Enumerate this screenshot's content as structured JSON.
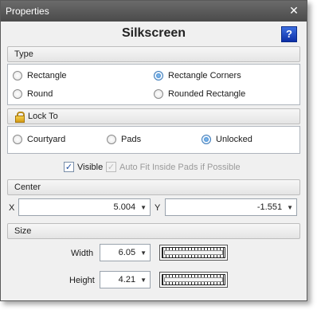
{
  "window": {
    "title": "Properties",
    "close_glyph": "✕"
  },
  "heading": "Silkscreen",
  "help_glyph": "?",
  "type_section": {
    "label": "Type",
    "options": [
      {
        "label": "Rectangle",
        "checked": false
      },
      {
        "label": "Rectangle Corners",
        "checked": true
      },
      {
        "label": "Round",
        "checked": false
      },
      {
        "label": "Rounded Rectangle",
        "checked": false
      }
    ]
  },
  "lock_section": {
    "label": "Lock To",
    "icon": "lock-icon",
    "options": [
      {
        "label": "Courtyard",
        "checked": false
      },
      {
        "label": "Pads",
        "checked": false
      },
      {
        "label": "Unlocked",
        "checked": true
      }
    ]
  },
  "visible": {
    "label": "Visible",
    "checked": true,
    "glyph": "✓"
  },
  "autofit": {
    "label": "Auto Fit Inside Pads if Possible",
    "checked": true,
    "glyph": "✓",
    "disabled": true
  },
  "center_section": {
    "label": "Center",
    "x_label": "X",
    "x_value": "5.004",
    "y_label": "Y",
    "y_value": "-1.551",
    "arrow": "▼"
  },
  "size_section": {
    "label": "Size",
    "width_label": "Width",
    "width_value": "6.05",
    "height_label": "Height",
    "height_value": "4.21",
    "arrow": "▼"
  }
}
